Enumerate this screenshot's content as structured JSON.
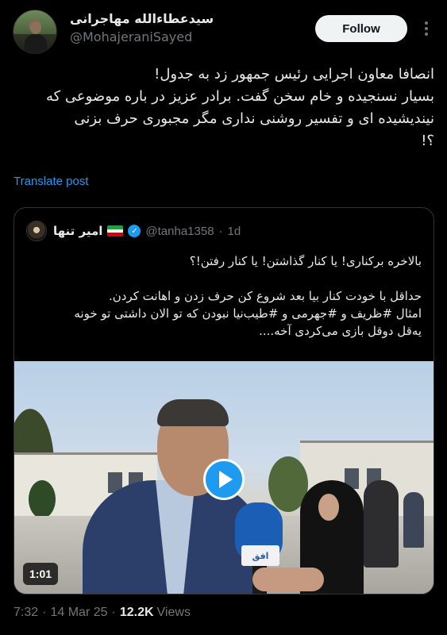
{
  "author": {
    "display_name": "سیدعطاءالله مهاجرانی",
    "handle": "@MohajeraniSayed",
    "avatar_icon": "profile-photo"
  },
  "follow_label": "Follow",
  "tweet": {
    "lines": [
      "انصافا معاون اجرایی رئیس جمهور زد به جدول!",
      "بسیار نسنجیده و خام سخن گفت. برادر عزیز در باره موضوعی که",
      "نیندیشیده ای و تفسیر روشنی نداری مگر مجبوری حرف بزنی",
      "؟!"
    ]
  },
  "translate_label": "Translate post",
  "quoted": {
    "display_name": "امیر تنها",
    "verified": true,
    "flag": "🇮🇷",
    "handle": "@tanha1358",
    "separator": "·",
    "time": "1d",
    "lines": [
      "بالاخره برکناری! یا کنار گذاشتن! یا کنار رفتن!؟",
      "",
      "حداقل با خودت کنار بیا بعد شروع کن حرف زدن و اهانت کردن.",
      "امثال #ظریف و #جهرمی و #طیب‌نیا نبودن که تو الان داشتی تو خونه",
      "یه‌قل دوقل بازی می‌کردی آخه...."
    ],
    "video": {
      "duration": "1:01",
      "mic_label": "افق"
    }
  },
  "footer": {
    "time": "7:32",
    "dot": "·",
    "date": "14 Mar 25",
    "views_count": "12.2K",
    "views_label": "Views"
  },
  "colors": {
    "accent": "#1d9bf0",
    "background": "#000000",
    "text": "#e7e9ea",
    "muted": "#71767b"
  }
}
